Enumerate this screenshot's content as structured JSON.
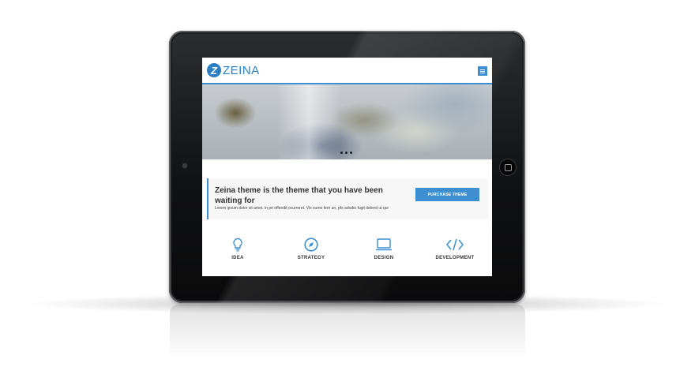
{
  "site": {
    "logo_letter": "Z",
    "logo_text": "ZEINA"
  },
  "colors": {
    "accent": "#3d8fd1",
    "tablet_body": "#111214",
    "text_dark": "#333333"
  },
  "callout": {
    "title": "Zeina theme is the theme that you have been waiting for",
    "text": "Lorem ipsum dolor sit amet, in pri offendit ocurreret. Vix sumo ferri an, pfs adodio fugit delenit ut qui",
    "button_label": "PURCHASE THEME"
  },
  "features": [
    {
      "label": "IDEA",
      "icon": "lightbulb-icon"
    },
    {
      "label": "STRATEGY",
      "icon": "compass-icon"
    },
    {
      "label": "DESIGN",
      "icon": "laptop-icon"
    },
    {
      "label": "DEVELOPMENT",
      "icon": "code-icon"
    }
  ],
  "slider": {
    "dot_count": 3
  }
}
